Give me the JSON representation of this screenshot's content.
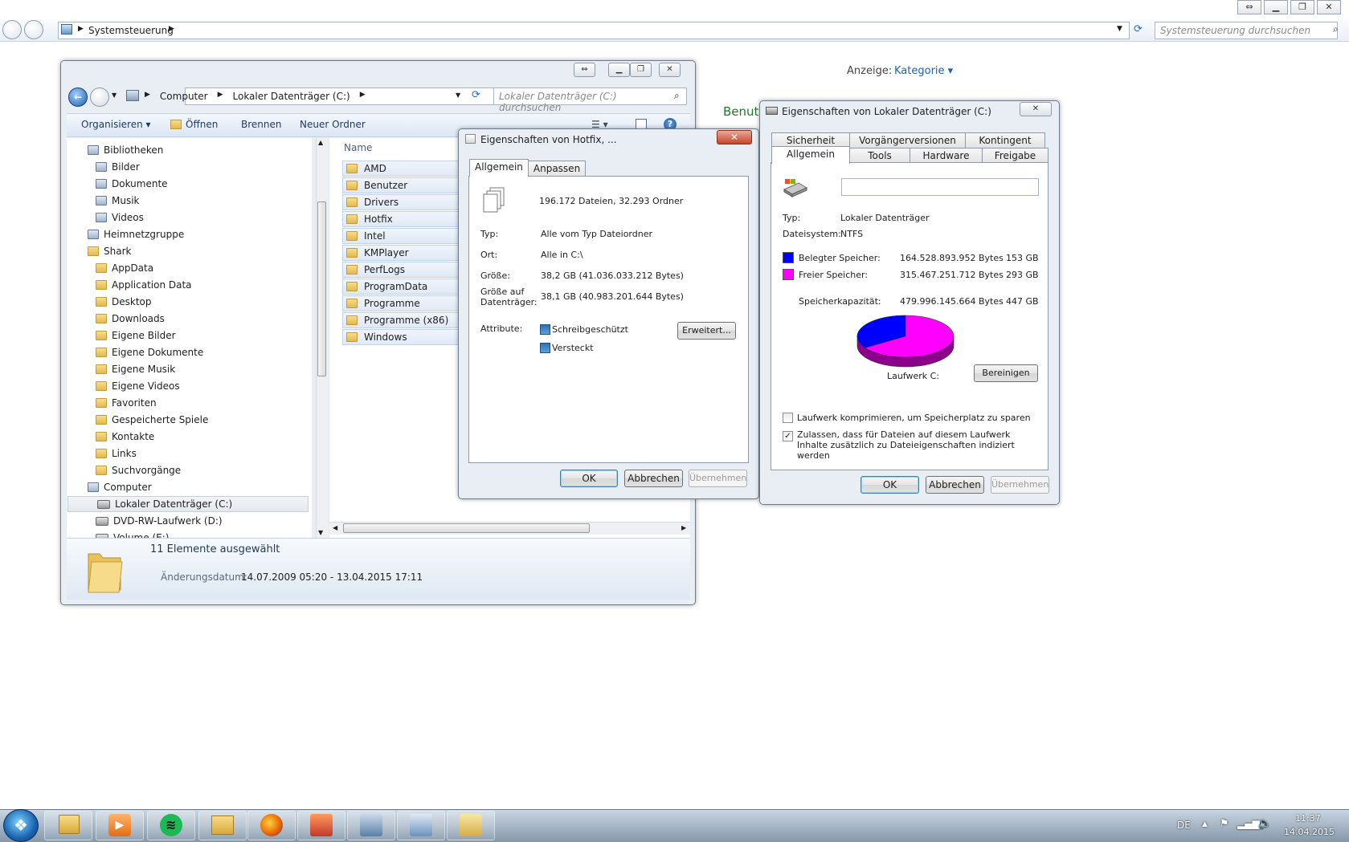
{
  "control_panel": {
    "breadcrumb": "Systemsteuerung",
    "search_placeholder": "Systemsteuerung durchsuchen",
    "view_label": "Anzeige:",
    "view_value": "Kategorie ▾",
    "user_heading": "Benutz"
  },
  "explorer": {
    "breadcrumb": [
      "Computer",
      "Lokaler Datenträger (C:)"
    ],
    "search_placeholder": "Lokaler Datenträger (C:) durchsuchen",
    "toolbar": {
      "organize": "Organisieren ▾",
      "open": "Öffnen",
      "burn": "Brennen",
      "new_folder": "Neuer Ordner"
    },
    "nav": [
      {
        "label": "Bibliotheken",
        "icon": "library-icon",
        "indent": 0
      },
      {
        "label": "Bilder",
        "icon": "library-icon",
        "indent": 1
      },
      {
        "label": "Dokumente",
        "icon": "library-icon",
        "indent": 1
      },
      {
        "label": "Musik",
        "icon": "music-icon",
        "indent": 1
      },
      {
        "label": "Videos",
        "icon": "library-icon",
        "indent": 1
      },
      {
        "label": "Heimnetzgruppe",
        "icon": "homegroup-icon",
        "indent": 0
      },
      {
        "label": "Shark",
        "icon": "user-folder-icon",
        "indent": 0
      },
      {
        "label": "AppData",
        "icon": "folder-icon",
        "indent": 1
      },
      {
        "label": "Application Data",
        "icon": "folder-icon",
        "indent": 1
      },
      {
        "label": "Desktop",
        "icon": "folder-icon",
        "indent": 1
      },
      {
        "label": "Downloads",
        "icon": "folder-icon",
        "indent": 1
      },
      {
        "label": "Eigene Bilder",
        "icon": "folder-icon",
        "indent": 1
      },
      {
        "label": "Eigene Dokumente",
        "icon": "folder-icon",
        "indent": 1
      },
      {
        "label": "Eigene Musik",
        "icon": "folder-icon",
        "indent": 1
      },
      {
        "label": "Eigene Videos",
        "icon": "folder-icon",
        "indent": 1
      },
      {
        "label": "Favoriten",
        "icon": "folder-icon",
        "indent": 1
      },
      {
        "label": "Gespeicherte Spiele",
        "icon": "folder-icon",
        "indent": 1
      },
      {
        "label": "Kontakte",
        "icon": "folder-icon",
        "indent": 1
      },
      {
        "label": "Links",
        "icon": "folder-icon",
        "indent": 1
      },
      {
        "label": "Suchvorgänge",
        "icon": "folder-icon",
        "indent": 1
      },
      {
        "label": "Computer",
        "icon": "computer-icon",
        "indent": 0
      },
      {
        "label": "Lokaler Datenträger (C:)",
        "icon": "drive-icon",
        "indent": 1,
        "selected": true
      },
      {
        "label": "DVD-RW-Laufwerk (D:)",
        "icon": "dvd-icon",
        "indent": 1
      },
      {
        "label": "Volume (E:)",
        "icon": "drive-icon",
        "indent": 1
      }
    ],
    "column_name": "Name",
    "files": [
      "AMD",
      "Benutzer",
      "Drivers",
      "Hotfix",
      "Intel",
      "KMPlayer",
      "PerfLogs",
      "ProgramData",
      "Programme",
      "Programme (x86)",
      "Windows"
    ],
    "details": {
      "selection": "11 Elemente ausgewählt",
      "date_label": "Änderungsdatum:",
      "date_value": "14.07.2009 05:20 - 13.04.2015 17:11"
    }
  },
  "hotfix_dialog": {
    "title": "Eigenschaften von Hotfix, ...",
    "tabs": [
      "Allgemein",
      "Anpassen"
    ],
    "summary": "196.172 Dateien, 32.293 Ordner",
    "rows": [
      {
        "label": "Typ:",
        "value": "Alle vom Typ Dateiordner"
      },
      {
        "label": "Ort:",
        "value": "Alle in C:\\"
      },
      {
        "label": "Größe:",
        "value": "38,2 GB (41.036.033.212 Bytes)"
      },
      {
        "label": "Größe auf Datenträger:",
        "value": "38,1 GB (40.983.201.644 Bytes)"
      }
    ],
    "attributes_label": "Attribute:",
    "readonly_label": "Schreibgeschützt",
    "hidden_label": "Versteckt",
    "advanced_button": "Erweitert...",
    "ok": "OK",
    "cancel": "Abbrechen",
    "apply": "Übernehmen"
  },
  "drive_dialog": {
    "title": "Eigenschaften von Lokaler Datenträger (C:)",
    "tabs_row1": [
      "Sicherheit",
      "Vorgängerversionen",
      "Kontingent"
    ],
    "tabs_row2": [
      "Allgemein",
      "Tools",
      "Hardware",
      "Freigabe"
    ],
    "type_label": "Typ:",
    "type_value": "Lokaler Datenträger",
    "fs_label": "Dateisystem:",
    "fs_value": "NTFS",
    "used_label": "Belegter Speicher:",
    "used_bytes": "164.528.893.952 Bytes",
    "used_gb": "153 GB",
    "free_label": "Freier Speicher:",
    "free_bytes": "315.467.251.712 Bytes",
    "free_gb": "293 GB",
    "capacity_label": "Speicherkapazität:",
    "capacity_bytes": "479.996.145.664 Bytes",
    "capacity_gb": "447 GB",
    "used_fraction": 0.343,
    "used_color": "#0000ff",
    "free_color": "#ff00ff",
    "drive_label": "Laufwerk C:",
    "cleanup_button": "Bereinigen",
    "compress_label": "Laufwerk komprimieren, um Speicherplatz zu sparen",
    "index_label": "Zulassen, dass für Dateien auf diesem Laufwerk Inhalte zusätzlich zu Dateieigenschaften indiziert werden",
    "ok": "OK",
    "cancel": "Abbrechen",
    "apply": "Übernehmen"
  },
  "taskbar": {
    "language": "DE",
    "time": "11:37",
    "date": "14.04.2015"
  }
}
